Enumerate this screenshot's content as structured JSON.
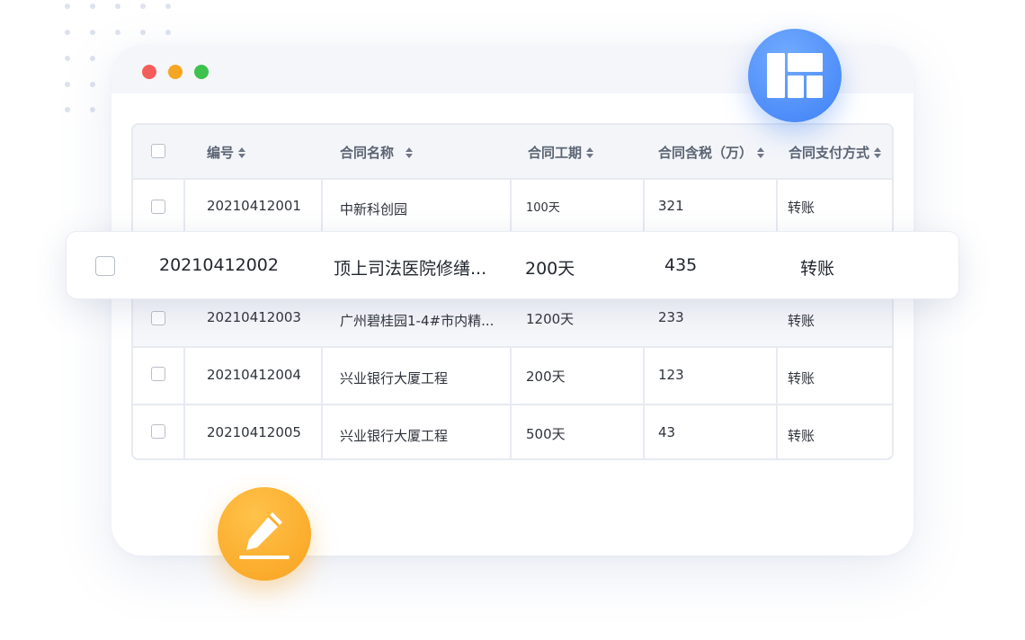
{
  "window": {
    "controls": {
      "close": "close-window",
      "minimize": "minimize-window",
      "maximize": "maximize-window"
    }
  },
  "table": {
    "columns": [
      "编号",
      "合同名称",
      "合同工期",
      "合同含税（万）",
      "合同支付方式"
    ],
    "rows": [
      {
        "id": "20210412001",
        "name": "中新科创园",
        "period": "100天",
        "amount": "321",
        "payment": "转账"
      },
      {
        "id": "20210412002",
        "name": "顶上司法医院修缮...",
        "period": "200天",
        "amount": "435",
        "payment": "转账"
      },
      {
        "id": "20210412003",
        "name": "广州碧桂园1-4#市内精...",
        "period": "1200天",
        "amount": "233",
        "payment": "转账"
      },
      {
        "id": "20210412004",
        "name": "兴业银行大厦工程",
        "period": "200天",
        "amount": "123",
        "payment": "转账"
      },
      {
        "id": "20210412005",
        "name": "兴业银行大厦工程",
        "period": "500天",
        "amount": "43",
        "payment": "转账"
      }
    ]
  },
  "icons": {
    "layout": "layout-grid-icon",
    "edit": "pencil-edit-icon"
  },
  "colors": {
    "accent_blue": "#3f81f6",
    "accent_orange": "#f9a21f",
    "dot_red": "#f55d5a",
    "dot_yellow": "#f6a623",
    "dot_green": "#3ec24e"
  }
}
